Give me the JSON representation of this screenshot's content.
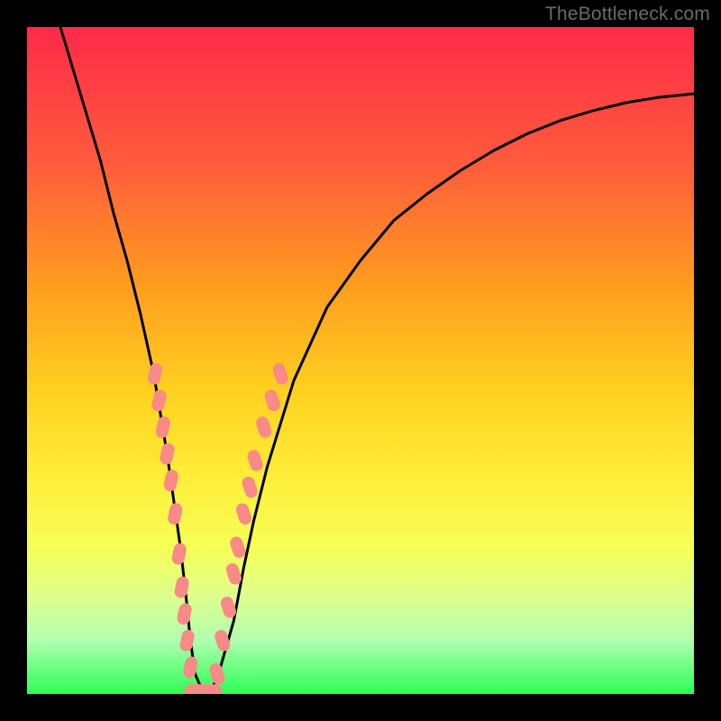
{
  "watermark": "TheBottleneck.com",
  "colors": {
    "background": "#000000",
    "curve": "#000000",
    "markers": "#f88a88",
    "gradient_stops": [
      "#ff2a4a",
      "#ff5a3c",
      "#ff9a1f",
      "#ffd21f",
      "#ffee3a",
      "#f5ff56",
      "#e0ff8a",
      "#b0ffb0",
      "#2bff55"
    ]
  },
  "chart_data": {
    "type": "line",
    "title": "",
    "xlabel": "",
    "ylabel": "",
    "xlim": [
      0,
      100
    ],
    "ylim": [
      0,
      100
    ],
    "grid": false,
    "legend": false,
    "series": [
      {
        "name": "bottleneck-curve",
        "x": [
          5,
          8,
          11,
          13,
          15,
          17,
          19,
          20,
          21,
          22,
          23,
          23.8,
          24.5,
          25.2,
          26.5,
          27.5,
          29,
          31,
          32.5,
          34,
          36,
          40,
          45,
          50,
          55,
          60,
          65,
          70,
          75,
          80,
          85,
          90,
          95,
          100
        ],
        "y": [
          100,
          90,
          80,
          72,
          65,
          57,
          48,
          42,
          36,
          29,
          22,
          15,
          8,
          3,
          0,
          0,
          4,
          11,
          19,
          26,
          34,
          47,
          58,
          65,
          71,
          75,
          78.5,
          81.5,
          84,
          86,
          87.5,
          88.7,
          89.5,
          90
        ]
      }
    ],
    "marker_clusters": [
      {
        "name": "left-descent",
        "points": [
          {
            "x": 19.2,
            "y": 48
          },
          {
            "x": 19.8,
            "y": 44
          },
          {
            "x": 20.4,
            "y": 40
          },
          {
            "x": 21.0,
            "y": 36
          },
          {
            "x": 21.6,
            "y": 32
          },
          {
            "x": 22.2,
            "y": 27
          },
          {
            "x": 22.8,
            "y": 21
          },
          {
            "x": 23.2,
            "y": 16
          },
          {
            "x": 23.6,
            "y": 12
          },
          {
            "x": 24.0,
            "y": 8
          },
          {
            "x": 24.5,
            "y": 4
          }
        ]
      },
      {
        "name": "right-ascent",
        "points": [
          {
            "x": 28.5,
            "y": 3
          },
          {
            "x": 29.3,
            "y": 8
          },
          {
            "x": 30.2,
            "y": 13
          },
          {
            "x": 31.0,
            "y": 18
          },
          {
            "x": 31.6,
            "y": 22
          },
          {
            "x": 32.5,
            "y": 27
          },
          {
            "x": 33.4,
            "y": 31
          },
          {
            "x": 34.2,
            "y": 35
          },
          {
            "x": 35.5,
            "y": 40
          },
          {
            "x": 36.8,
            "y": 44
          },
          {
            "x": 38.0,
            "y": 48
          }
        ]
      },
      {
        "name": "valley",
        "points": [
          {
            "x": 25.2,
            "y": 0.5
          },
          {
            "x": 26.0,
            "y": 0.5
          },
          {
            "x": 26.8,
            "y": 0.5
          },
          {
            "x": 27.6,
            "y": 0.5
          }
        ]
      }
    ]
  }
}
